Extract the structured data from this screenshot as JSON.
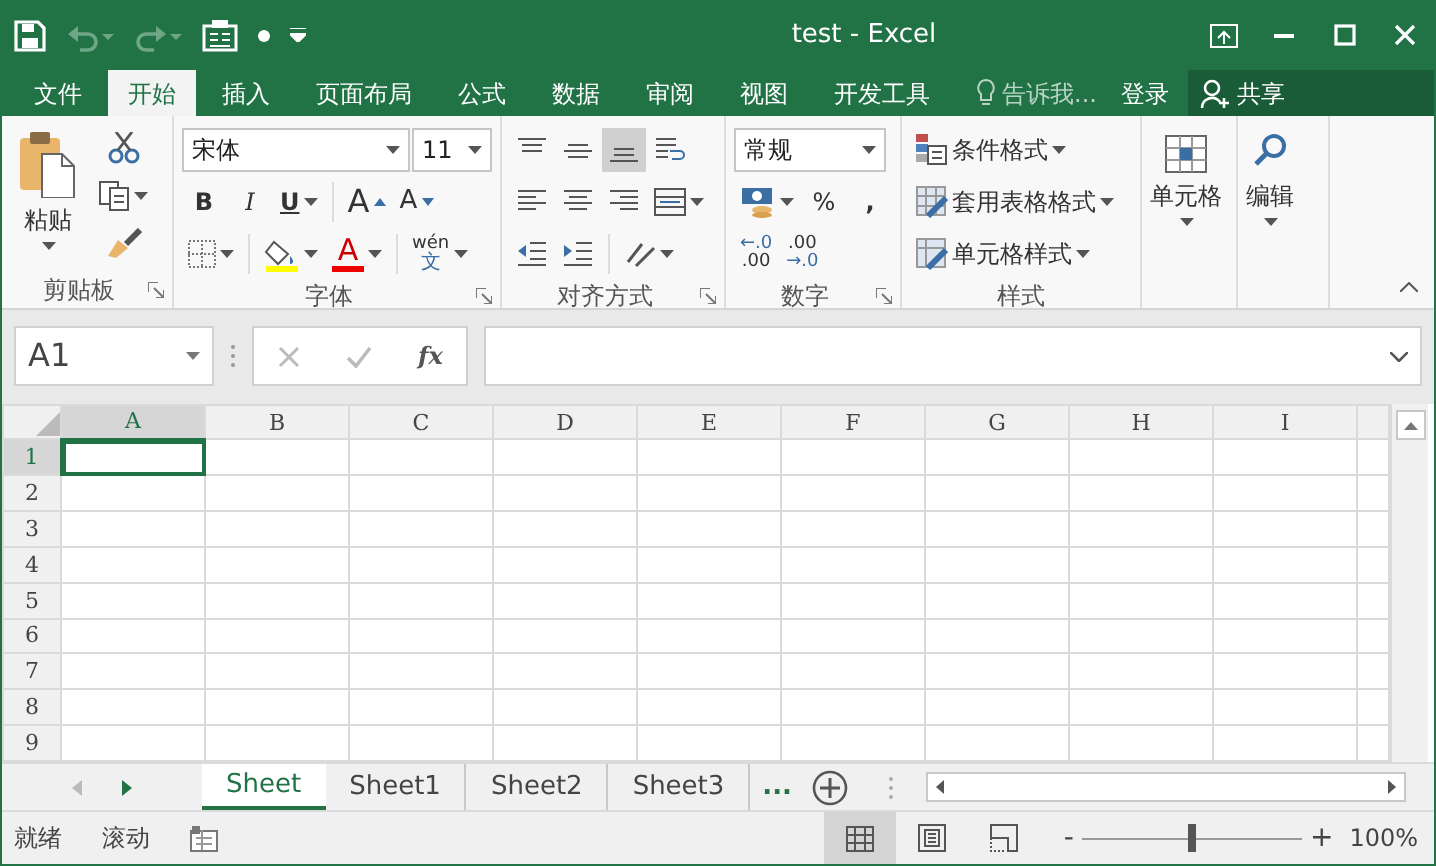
{
  "window": {
    "title": "test - Excel"
  },
  "quick_access": [
    {
      "kind": "save",
      "disabled": false
    },
    {
      "kind": "undo",
      "disabled": true
    },
    {
      "kind": "redo",
      "disabled": true
    },
    {
      "kind": "form",
      "disabled": false
    },
    {
      "kind": "dot",
      "disabled": false
    },
    {
      "kind": "customize",
      "disabled": false
    }
  ],
  "window_controls": [
    {
      "kind": "ribbon-options"
    },
    {
      "kind": "minimize"
    },
    {
      "kind": "maximize"
    },
    {
      "kind": "close"
    }
  ],
  "ribbon_tabs": [
    {
      "label": "文件",
      "selected": false
    },
    {
      "label": "开始",
      "selected": true
    },
    {
      "label": "插入",
      "selected": false
    },
    {
      "label": "页面布局",
      "selected": false
    },
    {
      "label": "公式",
      "selected": false
    },
    {
      "label": "数据",
      "selected": false
    },
    {
      "label": "审阅",
      "selected": false
    },
    {
      "label": "视图",
      "selected": false
    },
    {
      "label": "开发工具",
      "selected": false
    }
  ],
  "tell_me": {
    "placeholder": "告诉我..."
  },
  "sign_in": "登录",
  "share": "共享",
  "clipboard": {
    "paste": "粘贴",
    "label": "剪贴板"
  },
  "font": {
    "name": "宋体",
    "size": "11",
    "bold": "B",
    "italic": "I",
    "underline": "U",
    "grow": "A",
    "shrink": "A",
    "font_color": "A",
    "phonetic_top": "wén",
    "phonetic_bottom": "文",
    "label": "字体"
  },
  "alignment": {
    "buttons": [
      {
        "kind": "top",
        "selected": false
      },
      {
        "kind": "middle",
        "selected": false
      },
      {
        "kind": "bottom",
        "selected": true
      },
      {
        "kind": "wrap",
        "selected": false
      },
      {
        "kind": "left",
        "selected": false
      },
      {
        "kind": "center",
        "selected": false
      },
      {
        "kind": "right",
        "selected": false
      },
      {
        "kind": "merge",
        "selected": false
      },
      {
        "kind": "outdent",
        "selected": false
      },
      {
        "kind": "indent",
        "selected": false
      },
      {
        "kind": "orientation",
        "selected": false
      }
    ],
    "label": "对齐方式"
  },
  "number": {
    "format": "常规",
    "percent": "%",
    "comma": ",",
    "decimals": [
      {
        "top": "←.0",
        "bottom": ".00"
      },
      {
        "top": ".00",
        "bottom": "→.0"
      }
    ],
    "label": "数字"
  },
  "styles": {
    "items": [
      "条件格式",
      "套用表格格式",
      "单元格样式"
    ],
    "label": "样式"
  },
  "cells": {
    "label": "单元格"
  },
  "editing": {
    "label": "编辑"
  },
  "formula_bar": {
    "name_box": "A1",
    "function": "fx"
  },
  "sheet": {
    "columns": [
      {
        "label": "A",
        "selected": true
      },
      {
        "label": "B",
        "selected": false
      },
      {
        "label": "C",
        "selected": false
      },
      {
        "label": "D",
        "selected": false
      },
      {
        "label": "E",
        "selected": false
      },
      {
        "label": "F",
        "selected": false
      },
      {
        "label": "G",
        "selected": false
      },
      {
        "label": "H",
        "selected": false
      },
      {
        "label": "I",
        "selected": false
      }
    ],
    "rows": [
      {
        "label": "1",
        "selected": true
      },
      {
        "label": "2",
        "selected": false
      },
      {
        "label": "3",
        "selected": false
      },
      {
        "label": "4",
        "selected": false
      },
      {
        "label": "5",
        "selected": false
      },
      {
        "label": "6",
        "selected": false
      },
      {
        "label": "7",
        "selected": false
      },
      {
        "label": "8",
        "selected": false
      },
      {
        "label": "9",
        "selected": false
      }
    ]
  },
  "sheet_tabs": [
    {
      "label": "Sheet",
      "selected": true
    },
    {
      "label": "Sheet1",
      "selected": false
    },
    {
      "label": "Sheet2",
      "selected": false
    },
    {
      "label": "Sheet3",
      "selected": false
    }
  ],
  "more_sheets": "...",
  "status_bar": {
    "texts": [
      "就绪",
      "滚动"
    ],
    "views": [
      {
        "kind": "normal",
        "selected": true
      },
      {
        "kind": "page-layout",
        "selected": false
      },
      {
        "kind": "page-break",
        "selected": false
      }
    ],
    "zoom_out": "-",
    "zoom_in": "+",
    "zoom": {
      "level": 0.5
    },
    "zoom_text": "100%"
  }
}
